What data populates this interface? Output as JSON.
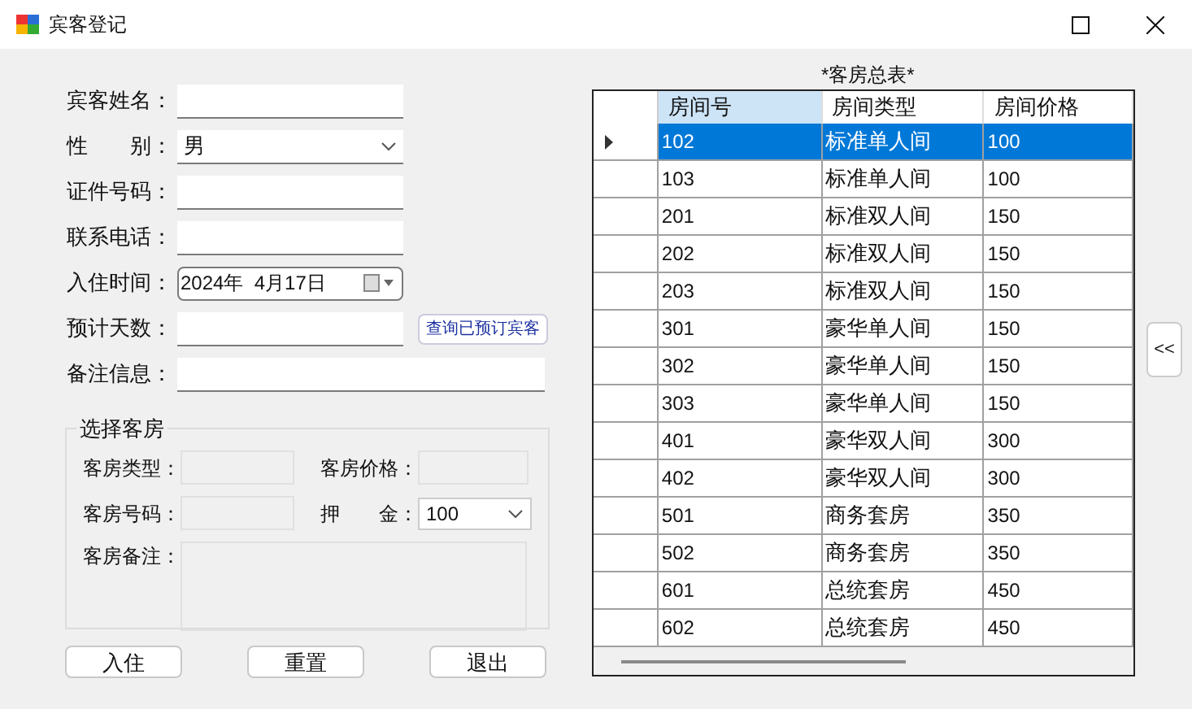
{
  "window": {
    "title": "宾客登记"
  },
  "form": {
    "fields": [
      {
        "kind": "text",
        "label": "宾客姓名："
      },
      {
        "kind": "select",
        "label": "性　　别：",
        "value": "男"
      },
      {
        "kind": "text",
        "label": "证件号码："
      },
      {
        "kind": "text",
        "label": "联系电话："
      },
      {
        "kind": "date",
        "label": "入住时间：",
        "value": "2024年  4月17日"
      },
      {
        "kind": "text",
        "label": "预计天数：",
        "action": "查询已预订宾客"
      },
      {
        "kind": "wide",
        "label": "备注信息："
      }
    ]
  },
  "room_group": {
    "title": "选择客房",
    "type_label": "客房类型：",
    "price_label": "客房价格：",
    "number_label": "客房号码：",
    "deposit_label": "押　　金：",
    "deposit_value": "100",
    "note_label": "客房备注："
  },
  "buttons": [
    "入住",
    "重置",
    "退出"
  ],
  "table": {
    "title": "*客房总表*",
    "columns": [
      {
        "label": "房间号",
        "selected": true
      },
      {
        "label": "房间类型",
        "selected": false
      },
      {
        "label": "房间价格",
        "selected": false
      }
    ],
    "rows": [
      {
        "selected": true,
        "cells": [
          "102",
          "标准单人间",
          "100"
        ]
      },
      {
        "selected": false,
        "cells": [
          "103",
          "标准单人间",
          "100"
        ]
      },
      {
        "selected": false,
        "cells": [
          "201",
          "标准双人间",
          "150"
        ]
      },
      {
        "selected": false,
        "cells": [
          "202",
          "标准双人间",
          "150"
        ]
      },
      {
        "selected": false,
        "cells": [
          "203",
          "标准双人间",
          "150"
        ]
      },
      {
        "selected": false,
        "cells": [
          "301",
          "豪华单人间",
          "150"
        ]
      },
      {
        "selected": false,
        "cells": [
          "302",
          "豪华单人间",
          "150"
        ]
      },
      {
        "selected": false,
        "cells": [
          "303",
          "豪华单人间",
          "150"
        ]
      },
      {
        "selected": false,
        "cells": [
          "401",
          "豪华双人间",
          "300"
        ]
      },
      {
        "selected": false,
        "cells": [
          "402",
          "豪华双人间",
          "300"
        ]
      },
      {
        "selected": false,
        "cells": [
          "501",
          "商务套房",
          "350"
        ]
      },
      {
        "selected": false,
        "cells": [
          "502",
          "商务套房",
          "350"
        ]
      },
      {
        "selected": false,
        "cells": [
          "601",
          "总统套房",
          "450"
        ]
      },
      {
        "selected": false,
        "cells": [
          "602",
          "总统套房",
          "450"
        ]
      }
    ]
  },
  "expand_button": "<<"
}
